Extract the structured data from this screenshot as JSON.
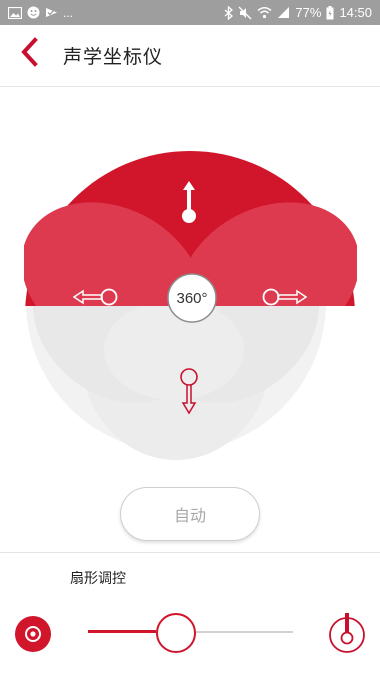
{
  "status_bar": {
    "dots": "...",
    "battery": "77%",
    "time": "14:50"
  },
  "header": {
    "title": "声学坐标仪",
    "back_icon": "chevron-left-icon"
  },
  "radar": {
    "center_label": "360°",
    "active_directions": [
      "up",
      "left",
      "right"
    ],
    "inactive_directions": [
      "down"
    ]
  },
  "auto_button": {
    "label": "自动"
  },
  "sector": {
    "label": "扇形调控",
    "slider_value": 0.43,
    "left_icon": "target-circle-icon",
    "right_icon": "mic-marker-icon"
  },
  "colors": {
    "accent": "#d1152b",
    "accent_dark": "#c8102e",
    "lobe_inactive": "#e6e6e6",
    "status_bar": "#9e9e9e"
  }
}
